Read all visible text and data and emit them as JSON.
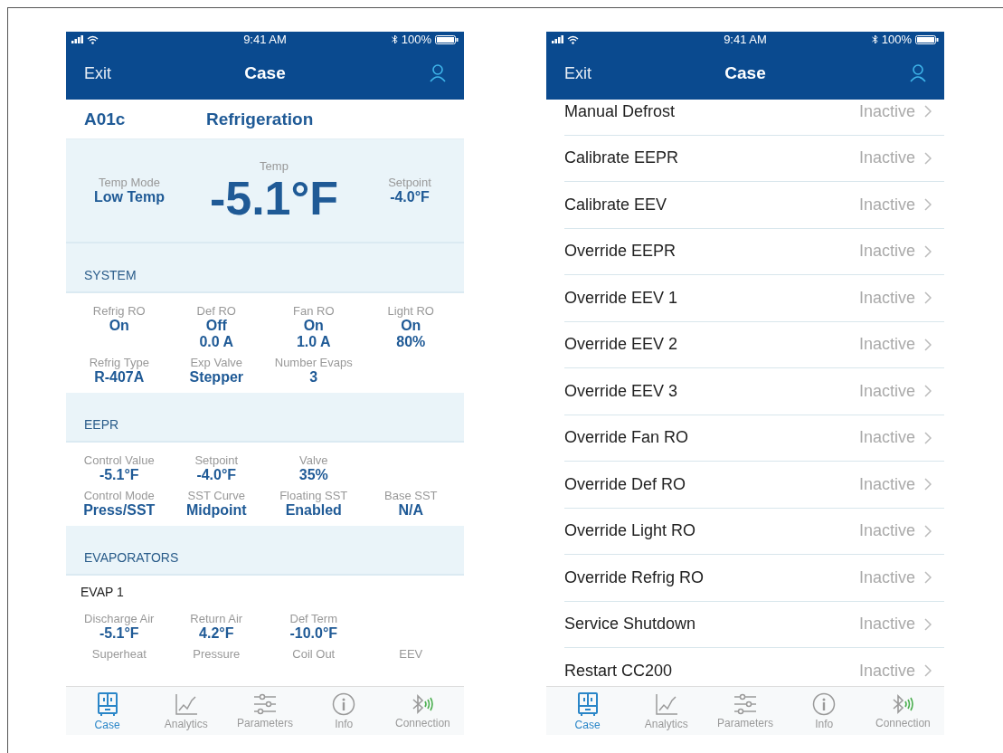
{
  "phones": [
    {
      "kind": "dashboard",
      "status": {
        "time": "9:41 AM",
        "battery": "100%"
      },
      "nav": {
        "left": "Exit",
        "title": "Case"
      },
      "header": {
        "id": "A01c",
        "title": "Refrigeration"
      },
      "temp": {
        "left_label": "Temp Mode",
        "left_value": "Low Temp",
        "label": "Temp",
        "value": "-5.1°F",
        "right_label": "Setpoint",
        "right_value": "-4.0°F"
      },
      "sections": [
        {
          "title": "SYSTEM",
          "rows": [
            [
              {
                "label": "Refrig RO",
                "value": "On"
              },
              {
                "label": "Def RO",
                "value": "Off\n0.0 A"
              },
              {
                "label": "Fan RO",
                "value": "On\n1.0 A"
              },
              {
                "label": "Light RO",
                "value": "On\n80%"
              }
            ],
            [
              {
                "label": "Refrig Type",
                "value": "R-407A"
              },
              {
                "label": "Exp Valve",
                "value": "Stepper"
              },
              {
                "label": "Number Evaps",
                "value": "3"
              }
            ]
          ]
        },
        {
          "title": "EEPR",
          "rows": [
            [
              {
                "label": "Control Value",
                "value": "-5.1°F"
              },
              {
                "label": "Setpoint",
                "value": "-4.0°F"
              },
              {
                "label": "Valve",
                "value": "35%"
              }
            ],
            [
              {
                "label": "Control Mode",
                "value": "Press/SST"
              },
              {
                "label": "SST Curve",
                "value": "Midpoint"
              },
              {
                "label": "Floating SST",
                "value": "Enabled"
              },
              {
                "label": "Base SST",
                "value": "N/A"
              }
            ]
          ]
        },
        {
          "title": "EVAPORATORS",
          "subtitle": "EVAP 1",
          "rows": [
            [
              {
                "label": "Discharge Air",
                "value": "-5.1°F"
              },
              {
                "label": "Return Air",
                "value": "4.2°F"
              },
              {
                "label": "Def Term",
                "value": "-10.0°F"
              }
            ],
            [
              {
                "label": "Superheat"
              },
              {
                "label": "Pressure"
              },
              {
                "label": "Coil Out"
              },
              {
                "label": "EEV"
              }
            ]
          ]
        }
      ],
      "tabs": [
        {
          "label": "Case",
          "selected": true
        },
        {
          "label": "Analytics",
          "selected": false
        },
        {
          "label": "Parameters",
          "selected": false
        },
        {
          "label": "Info",
          "selected": false
        },
        {
          "label": "Connection",
          "selected": false
        }
      ]
    },
    {
      "kind": "list",
      "status": {
        "time": "9:41 AM",
        "battery": "100%"
      },
      "nav": {
        "left": "Exit",
        "title": "Case"
      },
      "items": [
        {
          "label": "Manual Defrost",
          "status": "Inactive"
        },
        {
          "label": "Calibrate EEPR",
          "status": "Inactive"
        },
        {
          "label": "Calibrate EEV",
          "status": "Inactive"
        },
        {
          "label": "Override EEPR",
          "status": "Inactive"
        },
        {
          "label": "Override EEV 1",
          "status": "Inactive"
        },
        {
          "label": "Override EEV 2",
          "status": "Inactive"
        },
        {
          "label": "Override EEV 3",
          "status": "Inactive"
        },
        {
          "label": "Override Fan RO",
          "status": "Inactive"
        },
        {
          "label": "Override Def RO",
          "status": "Inactive"
        },
        {
          "label": "Override Light RO",
          "status": "Inactive"
        },
        {
          "label": "Override Refrig RO",
          "status": "Inactive"
        },
        {
          "label": "Service Shutdown",
          "status": "Inactive"
        },
        {
          "label": "Restart CC200",
          "status": "Inactive"
        }
      ],
      "tabs": [
        {
          "label": "Case",
          "selected": true
        },
        {
          "label": "Analytics",
          "selected": false
        },
        {
          "label": "Parameters",
          "selected": false
        },
        {
          "label": "Info",
          "selected": false
        },
        {
          "label": "Connection",
          "selected": false
        }
      ]
    }
  ]
}
